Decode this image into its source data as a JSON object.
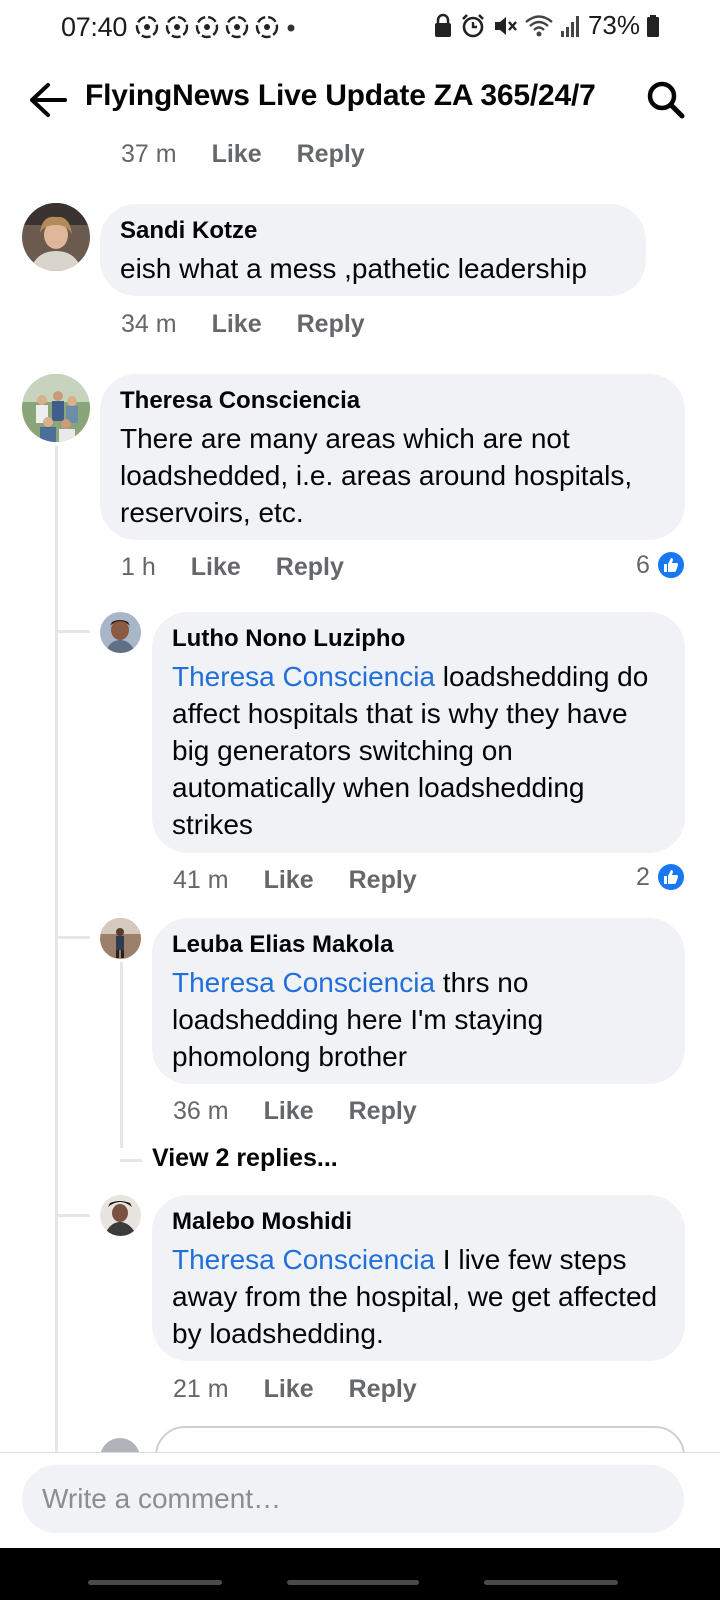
{
  "status_bar": {
    "time": "07:40",
    "battery": "73%",
    "notification_icons": [
      "sync-icon",
      "sync-icon",
      "sync-icon",
      "sync-icon",
      "sync-icon",
      "dot-icon"
    ],
    "system_icons": [
      "lock-icon",
      "alarm-icon",
      "mute-icon",
      "wifi-icon",
      "signal-icon",
      "battery-icon"
    ]
  },
  "header": {
    "title": "FlyingNews Live Update ZA 365/24/7",
    "back_icon": "arrow-left-icon",
    "search_icon": "search-icon"
  },
  "comments": [
    {
      "id": "prev",
      "time": "37 m",
      "like": "Like",
      "reply": "Reply"
    },
    {
      "id": "sandi",
      "author": "Sandi Kotze",
      "text": "eish what a mess ,pathetic leadership",
      "time": "34 m",
      "like": "Like",
      "reply": "Reply"
    },
    {
      "id": "theresa",
      "author": "Theresa Consciencia",
      "text": "There are many areas which are not loadshedded, i.e. areas around hospitals, reservoirs, etc.",
      "time": "1 h",
      "like": "Like",
      "reply": "Reply",
      "reactions": "6"
    },
    {
      "id": "lutho",
      "author": "Lutho Nono Luzipho",
      "mention": "Theresa Consciencia",
      "text": " loadshedding do affect hospitals that is why they have big generators switching on automatically when loadshedding strikes",
      "time": "41 m",
      "like": "Like",
      "reply": "Reply",
      "reactions": "2"
    },
    {
      "id": "leuba",
      "author": "Leuba Elias Makola",
      "mention": "Theresa Consciencia",
      "text": " thrs no loadshedding here I'm staying phomolong brother",
      "time": "36 m",
      "like": "Like",
      "reply": "Reply",
      "view_replies": "View 2 replies..."
    },
    {
      "id": "malebo",
      "author": "Malebo Moshidi",
      "mention": "Theresa Consciencia",
      "text": " I live few steps away from the hospital, we get affected by loadshedding.",
      "time": "21 m",
      "like": "Like",
      "reply": "Reply"
    }
  ],
  "composer": {
    "placeholder": "Write a comment…"
  },
  "colors": {
    "bubble": "#f0f2f5",
    "mention": "#216fdb",
    "meta": "#65676b",
    "like_blue": "#1877f2"
  }
}
